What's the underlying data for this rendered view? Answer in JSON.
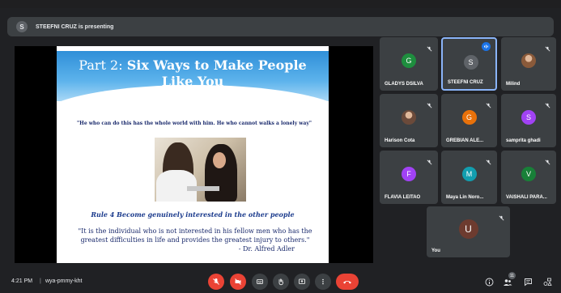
{
  "presenter_banner": {
    "avatar_letter": "S",
    "text": "STEEFNI CRUZ is presenting"
  },
  "slide": {
    "title_prefix": "Part 2: ",
    "title_bold_line1": "Six Ways to Make People",
    "title_bold_line2": "Like You",
    "quote1": "\"He who can do this has the whole world with him. He who cannot walks a lonely way\"",
    "rule": "Rule 4 Become genuinely interested in the other people",
    "quote2": "\"It is the individual who is not interested in his fellow men who has the greatest difficulties in life and provides the greatest injury to others.\"",
    "quote2_author": "- Dr. Alfred Adler"
  },
  "participants": [
    {
      "letter": "G",
      "name": "GLADYS DSILVA",
      "color": "#1e8e3e",
      "muted": true,
      "speaking": false,
      "photo": false
    },
    {
      "letter": "S",
      "name": "STEEFNI CRUZ",
      "color": "#5f6368",
      "muted": false,
      "speaking": true,
      "photo": false
    },
    {
      "letter": "",
      "name": "Milind",
      "color": "#8a5a3a",
      "muted": true,
      "speaking": false,
      "photo": true
    },
    {
      "letter": "",
      "name": "Harison Cota",
      "color": "#6b4a3a",
      "muted": true,
      "speaking": false,
      "photo": true
    },
    {
      "letter": "G",
      "name": "GREBIAN ALE...",
      "color": "#e8710a",
      "muted": true,
      "speaking": false,
      "photo": false
    },
    {
      "letter": "S",
      "name": "samprita ghadi",
      "color": "#a142f4",
      "muted": true,
      "speaking": false,
      "photo": false
    },
    {
      "letter": "F",
      "name": "FLAVIA LEITAO",
      "color": "#a142f4",
      "muted": true,
      "speaking": false,
      "photo": false
    },
    {
      "letter": "M",
      "name": "Maya Lin Noro...",
      "color": "#129eaf",
      "muted": true,
      "speaking": false,
      "photo": false
    },
    {
      "letter": "V",
      "name": "VAISHALI PARA...",
      "color": "#188038",
      "muted": true,
      "speaking": false,
      "photo": false
    },
    {
      "letter": "U",
      "name": "You",
      "color": "#6d3b2f",
      "muted": true,
      "speaking": false,
      "photo": false
    }
  ],
  "bottom": {
    "time": "4:21 PM",
    "separator": "|",
    "meeting_code": "wya-pmmy-kht",
    "people_badge": "11"
  },
  "icons": {
    "mic": "mic-off-icon",
    "camera": "camera-off-icon",
    "captions": "captions-icon",
    "hand": "raise-hand-icon",
    "present": "present-screen-icon",
    "more": "more-options-icon",
    "hangup": "hangup-icon",
    "info": "info-icon",
    "people": "people-icon",
    "chat": "chat-icon",
    "activities": "activities-icon"
  }
}
